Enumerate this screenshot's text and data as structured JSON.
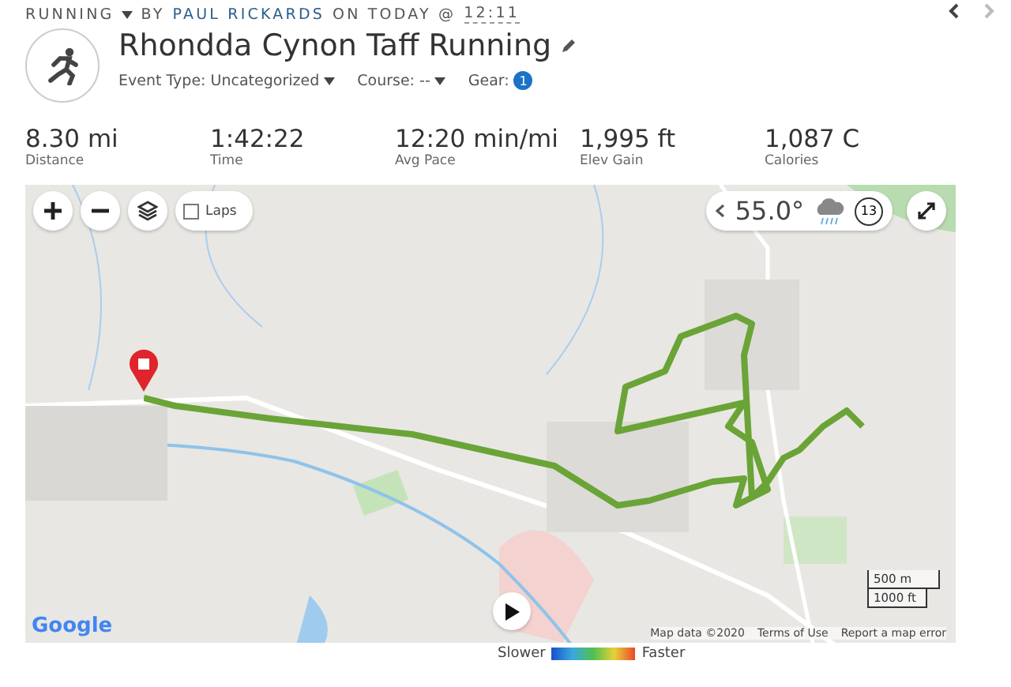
{
  "breadcrumb": {
    "activity_type": "RUNNING",
    "by": "BY",
    "author": "PAUL RICKARDS",
    "on": "ON TODAY @",
    "time": "12:11"
  },
  "title": "Rhondda Cynon Taff Running",
  "meta": [
    {
      "label": "Event Type: Uncategorized",
      "kind": "dropdown"
    },
    {
      "label": "Course: --",
      "kind": "dropdown"
    },
    {
      "label": "Gear:",
      "kind": "count",
      "count": "1"
    }
  ],
  "stats": [
    {
      "value": "8.30 mi",
      "label": "Distance"
    },
    {
      "value": "1:42:22",
      "label": "Time"
    },
    {
      "value": "12:20 min/mi",
      "label": "Avg Pace"
    },
    {
      "value": "1,995 ft",
      "label": "Elev Gain"
    },
    {
      "value": "1,087 C",
      "label": "Calories"
    }
  ],
  "map": {
    "laps": {
      "label": "Laps",
      "checked": false
    },
    "weather": {
      "temperature": "55.0°",
      "wind": "13"
    },
    "scale": [
      "500 m",
      "1000 ft"
    ],
    "attribution": [
      "Google",
      "Map data ©2020",
      "Terms of Use",
      "Report a map error"
    ]
  },
  "legend": {
    "slower": "Slower",
    "faster": "Faster"
  }
}
